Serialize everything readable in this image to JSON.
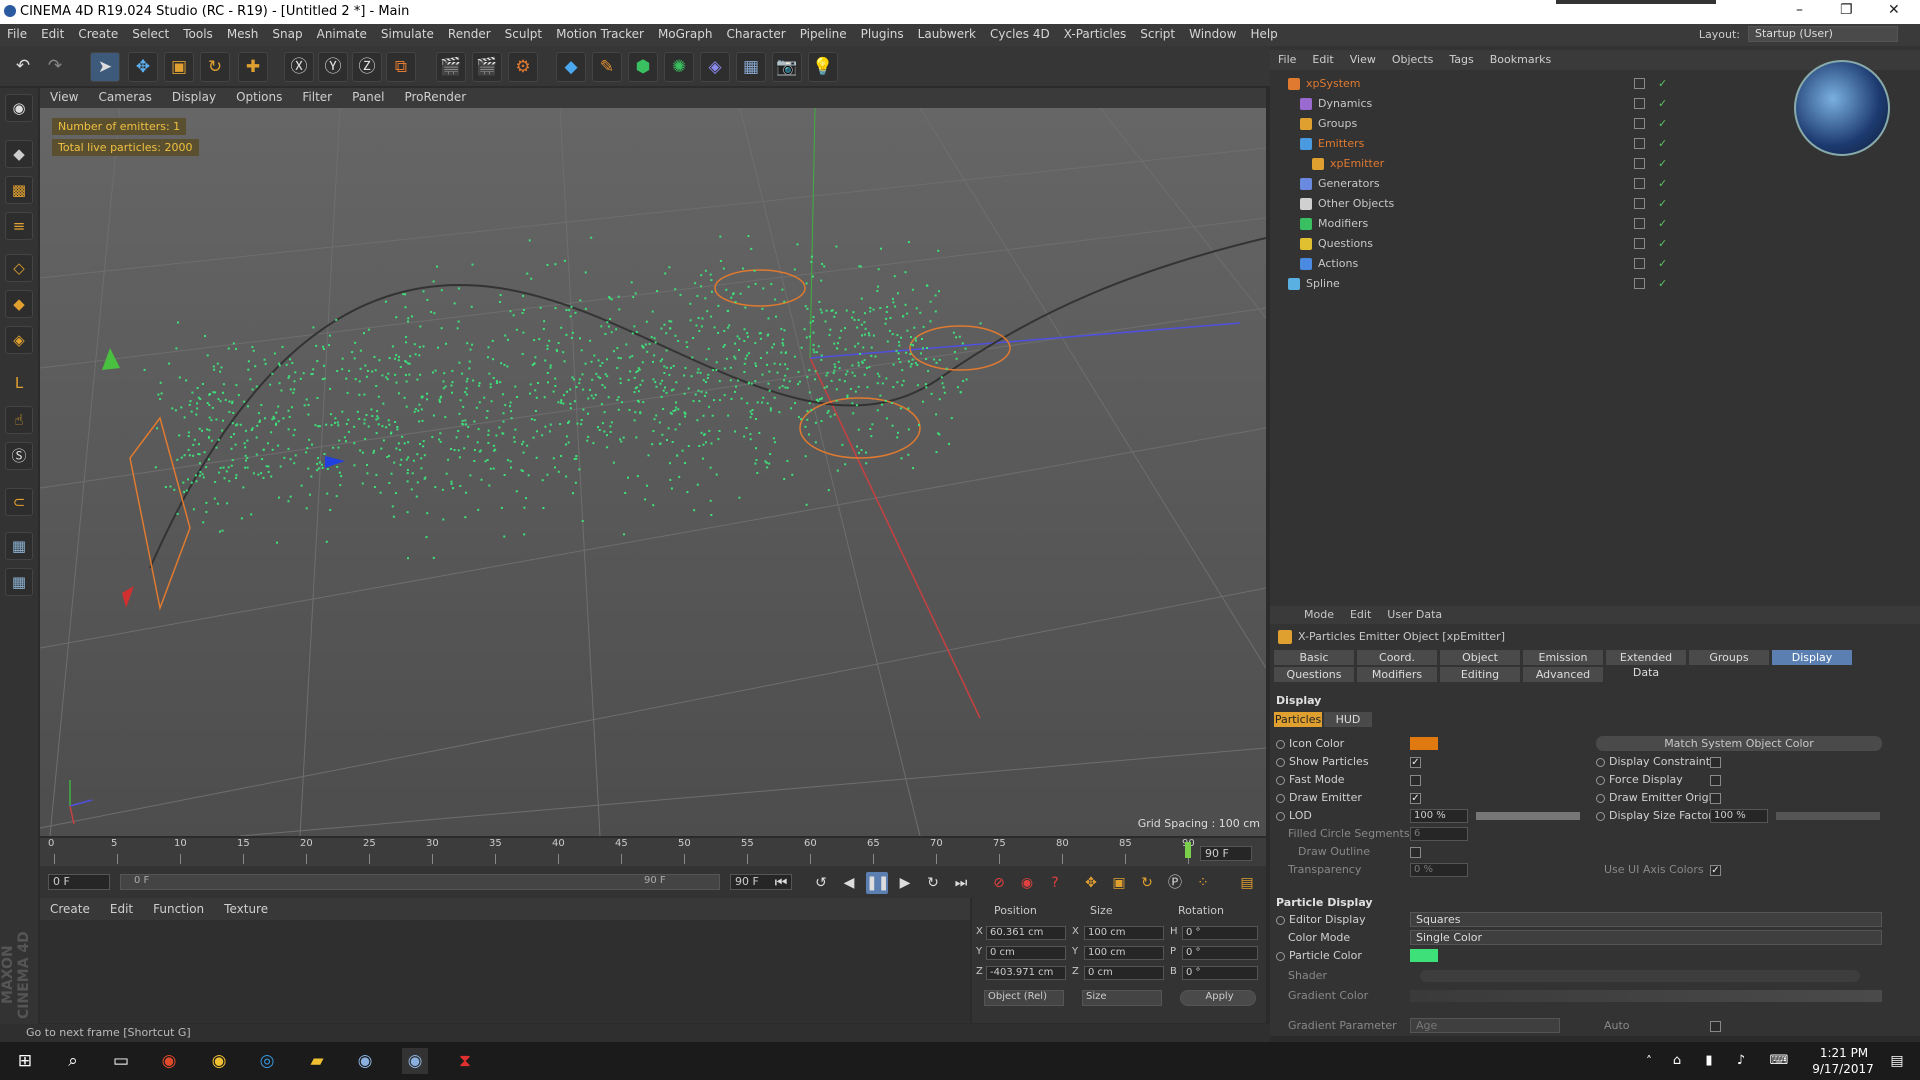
{
  "window": {
    "title": "CINEMA 4D R19.024 Studio (RC - R19) - [Untitled 2 *] - Main",
    "minimize_icon": "–",
    "maximize_icon": "❐",
    "close_icon": "✕"
  },
  "menubar": {
    "items": [
      "File",
      "Edit",
      "Create",
      "Select",
      "Tools",
      "Mesh",
      "Snap",
      "Animate",
      "Simulate",
      "Render",
      "Sculpt",
      "Motion Tracker",
      "MoGraph",
      "Character",
      "Pipeline",
      "Plugins",
      "Laubwerk",
      "Cycles 4D",
      "X-Particles",
      "Script",
      "Window",
      "Help"
    ],
    "layout_label": "Layout:",
    "layout_value": "Startup (User)"
  },
  "viewport": {
    "menu": [
      "View",
      "Cameras",
      "Display",
      "Options",
      "Filter",
      "Panel",
      "ProRender"
    ],
    "hud_emitters": "Number of emitters: 1",
    "hud_particles": "Total live particles: 2000",
    "grid_spacing": "Grid Spacing : 100 cm",
    "particle_color": "#3ee07a",
    "particle_count_shown": 2000
  },
  "timeline": {
    "ticks": [
      "0",
      "5",
      "10",
      "15",
      "20",
      "25",
      "30",
      "35",
      "40",
      "45",
      "50",
      "55",
      "60",
      "65",
      "70",
      "75",
      "80",
      "85",
      "90"
    ],
    "current_frame": "90 F",
    "current_frame_value": 90
  },
  "transport": {
    "start_field": "0 F",
    "range_start": "0 F",
    "range_end": "90 F",
    "end_field": "90 F"
  },
  "material_manager": {
    "menu": [
      "Create",
      "Edit",
      "Function",
      "Texture"
    ]
  },
  "coordinates": {
    "headers": {
      "position": "Position",
      "size": "Size",
      "rotation": "Rotation"
    },
    "rows": [
      {
        "axis": "X",
        "pos": "60.361 cm",
        "size_axis": "X",
        "size": "100 cm",
        "rot_axis": "H",
        "rot": "0 °"
      },
      {
        "axis": "Y",
        "pos": "0 cm",
        "size_axis": "Y",
        "size": "100 cm",
        "rot_axis": "P",
        "rot": "0 °"
      },
      {
        "axis": "Z",
        "pos": "-403.971 cm",
        "size_axis": "Z",
        "size": "0 cm",
        "rot_axis": "B",
        "rot": "0 °"
      }
    ],
    "mode": "Object (Rel)",
    "size_mode": "Size",
    "apply": "Apply"
  },
  "status": {
    "text": "Go to next frame [Shortcut G]"
  },
  "object_manager": {
    "menu": [
      "File",
      "Edit",
      "View",
      "Objects",
      "Tags",
      "Bookmarks"
    ],
    "objects": [
      {
        "name": "xpSystem",
        "color": "#e07a30",
        "highlight": true
      },
      {
        "name": "Dynamics",
        "color": "#9a6ad0",
        "highlight": false
      },
      {
        "name": "Groups",
        "color": "#e0a030",
        "highlight": false
      },
      {
        "name": "Emitters",
        "color": "#4a9ae0",
        "highlight": true
      },
      {
        "name": "xpEmitter",
        "color": "#e0a030",
        "highlight": true
      },
      {
        "name": "Generators",
        "color": "#6a8ae0",
        "highlight": false
      },
      {
        "name": "Other Objects",
        "color": "#d0d0d0",
        "highlight": false
      },
      {
        "name": "Modifiers",
        "color": "#3ac060",
        "highlight": false
      },
      {
        "name": "Questions",
        "color": "#e0c030",
        "highlight": false
      },
      {
        "name": "Actions",
        "color": "#4a8ae0",
        "highlight": false
      },
      {
        "name": "Spline",
        "color": "#5ab0e0",
        "highlight": false
      }
    ]
  },
  "attribute_manager": {
    "menu": [
      "Mode",
      "Edit",
      "User Data"
    ],
    "object_title": "X-Particles Emitter Object [xpEmitter]",
    "tabs_row1": [
      "Basic",
      "Coord.",
      "Object",
      "Emission",
      "Extended Data",
      "Groups",
      "Display"
    ],
    "tabs_row2": [
      "Questions",
      "Modifiers",
      "Editing",
      "Advanced"
    ],
    "selected_tab": "Display",
    "section_display": "Display",
    "subtabs": [
      "Particles",
      "HUD"
    ],
    "icon_color_label": "Icon Color",
    "icon_color": "#e07a10",
    "match_button": "Match System Object Color",
    "show_particles": "Show Particles",
    "fast_mode": "Fast Mode",
    "draw_emitter": "Draw Emitter",
    "lod": "LOD",
    "lod_value": "100 %",
    "filled_circle": "Filled Circle Segments",
    "filled_circle_value": "6",
    "draw_outline": "Draw Outline",
    "transparency": "Transparency",
    "transparency_value": "0 %",
    "display_constraints": "Display Constraints",
    "force_display": "Force Display",
    "draw_emitter_origin": "Draw Emitter Origin",
    "display_size_factor": "Display Size Factor",
    "display_size_value": "100 %",
    "use_ui_axis_colors": "Use UI Axis Colors",
    "section_particle_display": "Particle Display",
    "editor_display": "Editor Display",
    "editor_display_value": "Squares",
    "color_mode": "Color Mode",
    "color_mode_value": "Single Color",
    "particle_color": "Particle Color",
    "particle_color_value": "#3ee07a",
    "shader": "Shader",
    "gradient_color": "Gradient Color",
    "gradient_parameter": "Gradient Parameter",
    "gradient_parameter_value": "Age",
    "auto": "Auto"
  },
  "taskbar": {
    "time": "1:21 PM",
    "date": "9/17/2017"
  }
}
